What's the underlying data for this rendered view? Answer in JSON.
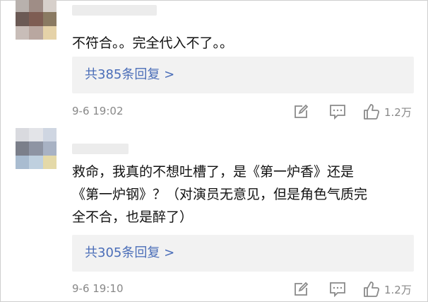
{
  "comments": [
    {
      "text_lines": [
        "不符合。。完全代入不了。。"
      ],
      "reply_label": "共385条回复 >",
      "time": "9-6 19:02",
      "likes": "1.2万",
      "avatar_colors": [
        "#b8b1ad",
        "#9f8d86",
        "#d7d0cb",
        "#6b5a55",
        "#7e5d53",
        "#8a7a62",
        "#c8bdb8",
        "#b9a7a0",
        "#e5d2a8"
      ]
    },
    {
      "text_lines": [
        "救命，我真的不想吐槽了，是《第一炉香》还是",
        "《第一炉钢》？（对演员无意见，但是角色气质完",
        "全不合，也是醉了）"
      ],
      "reply_label": "共305条回复 >",
      "time": "9-6 19:10",
      "likes": "1.2万",
      "avatar_colors": [
        "#d9dadf",
        "#e3e4e8",
        "#cfd6e2",
        "#7b7f8a",
        "#8e94a3",
        "#a8b2c4",
        "#a9bcd0",
        "#bfd0df",
        "#e4d9a8"
      ]
    }
  ],
  "icons": {
    "edit": "edit-icon",
    "comment": "comment-icon",
    "like": "thumbs-up-icon"
  },
  "colors": {
    "link": "#4a6db8",
    "meta": "#888888",
    "reply_bg": "#f2f2f2"
  }
}
